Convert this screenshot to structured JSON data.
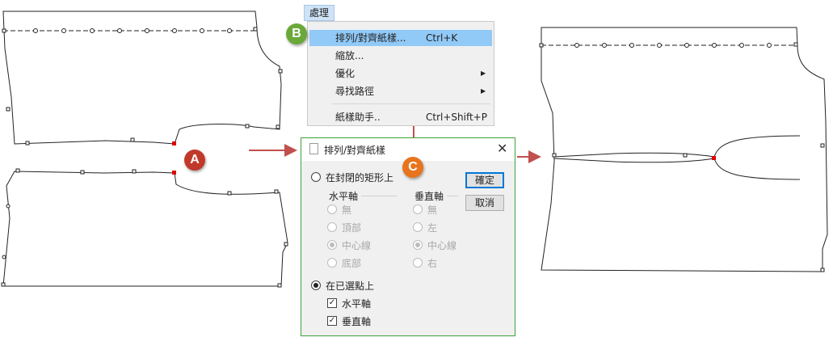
{
  "colors": {
    "arrow": "#c0504d",
    "badge_a": "#c0392b",
    "badge_b": "#6aa83a",
    "badge_c": "#e8741e",
    "menu_highlight": "#91c9f7",
    "dialog_border": "#3aa33a"
  },
  "menu": {
    "tab_label": "處理",
    "items": [
      {
        "label": "排列/對齊紙樣...",
        "shortcut": "Ctrl+K"
      },
      {
        "label": "縮放..."
      },
      {
        "label": "優化"
      },
      {
        "label": "尋找路徑"
      },
      {
        "label": "紙樣助手..",
        "shortcut": "Ctrl+Shift+P"
      }
    ]
  },
  "dialog": {
    "title": "排列/對齊紙樣",
    "option_rect": "在封閉的矩形上",
    "horizontal_axis": "水平軸",
    "vertical_axis": "垂直軸",
    "h_options": [
      "無",
      "頂部",
      "中心線",
      "底部"
    ],
    "v_options": [
      "無",
      "左",
      "中心線",
      "右"
    ],
    "option_points": "在已選點上",
    "chk_horizontal": "水平軸",
    "chk_vertical": "垂直軸",
    "ok": "確定",
    "cancel": "取消"
  },
  "badges": {
    "a": "A",
    "b": "B",
    "c": "C"
  },
  "icons": {
    "checkbox": "✓",
    "close": "✕",
    "submenu": "▶"
  }
}
